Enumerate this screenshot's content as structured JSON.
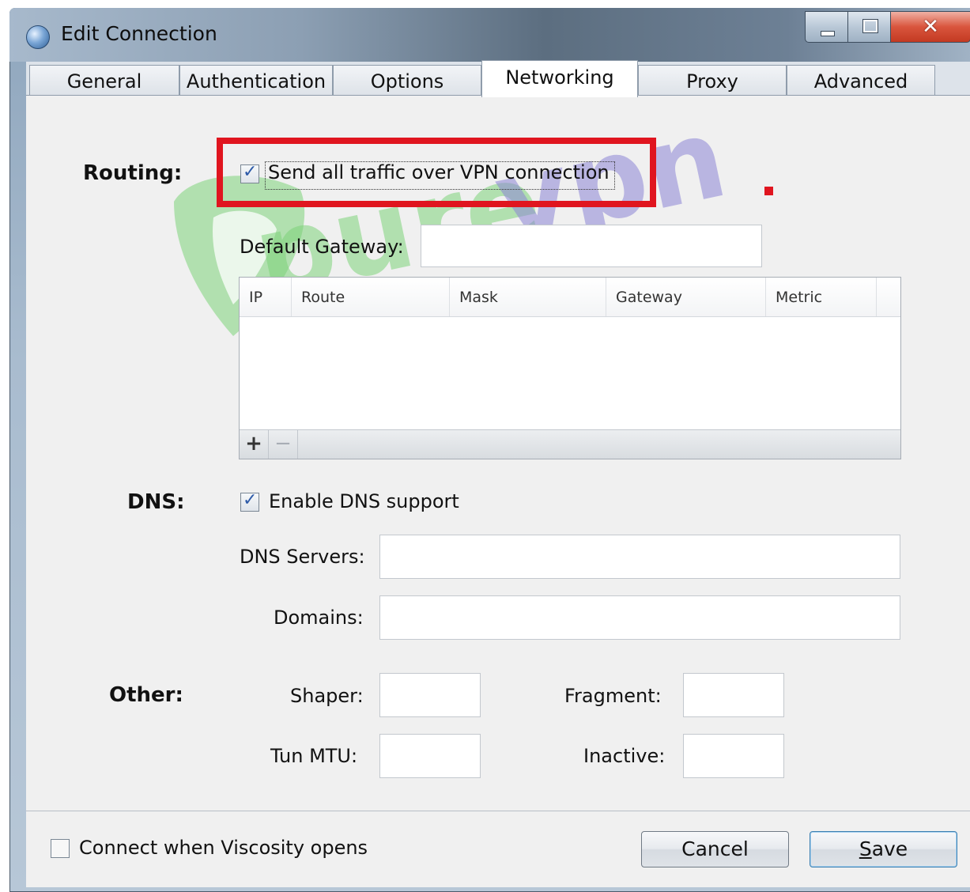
{
  "window": {
    "title": "Edit Connection"
  },
  "tabs": [
    {
      "label": "General"
    },
    {
      "label": "Authentication"
    },
    {
      "label": "Options"
    },
    {
      "label": "Networking"
    },
    {
      "label": "Proxy"
    },
    {
      "label": "Advanced"
    }
  ],
  "active_tab": "Networking",
  "watermark": {
    "brand": "purevpn"
  },
  "routing": {
    "section_label": "Routing:",
    "send_all_traffic": {
      "label": "Send all traffic over VPN connection",
      "checked": true
    },
    "default_gateway": {
      "label": "Default Gateway:",
      "value": ""
    },
    "routes_table": {
      "columns": [
        "IP",
        "Route",
        "Mask",
        "Gateway",
        "Metric"
      ],
      "rows": [],
      "add_label": "+",
      "remove_label": "−"
    }
  },
  "dns": {
    "section_label": "DNS:",
    "enable_dns": {
      "label": "Enable DNS support",
      "checked": true
    },
    "servers": {
      "label": "DNS Servers:",
      "value": ""
    },
    "domains": {
      "label": "Domains:",
      "value": ""
    }
  },
  "other": {
    "section_label": "Other:",
    "shaper": {
      "label": "Shaper:",
      "value": ""
    },
    "tun_mtu": {
      "label": "Tun MTU:",
      "value": ""
    },
    "fragment": {
      "label": "Fragment:",
      "value": ""
    },
    "inactive": {
      "label": "Inactive:",
      "value": ""
    }
  },
  "footer": {
    "connect_on_open": {
      "label": "Connect when Viscosity opens",
      "checked": false
    },
    "cancel_label": "Cancel",
    "save_label_first": "S",
    "save_label_rest": "ave"
  },
  "colors": {
    "highlight_red": "#e0151f",
    "watermark_green": "#7ed37a",
    "watermark_purple": "#8d86d6",
    "checkbox_tick": "#2d5aa8"
  }
}
